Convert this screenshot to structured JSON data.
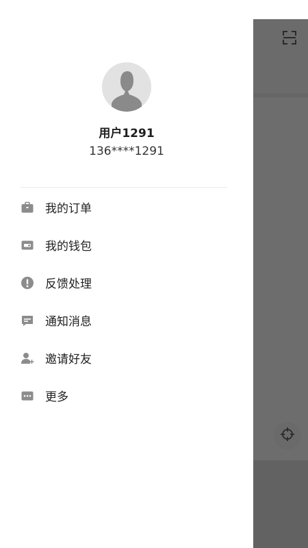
{
  "user": {
    "name": "用户1291",
    "phone": "136****1291",
    "avatar_icon": "avatar-placeholder-icon"
  },
  "menu": {
    "items": [
      {
        "label": "我的订单",
        "icon": "briefcase-icon"
      },
      {
        "label": "我的钱包",
        "icon": "wallet-icon"
      },
      {
        "label": "反馈处理",
        "icon": "exclamation-circle-icon"
      },
      {
        "label": "通知消息",
        "icon": "message-icon"
      },
      {
        "label": "邀请好友",
        "icon": "add-user-icon"
      },
      {
        "label": "更多",
        "icon": "more-icon"
      }
    ]
  },
  "underlay": {
    "top_action_icon": "scan-icon",
    "locate_icon": "crosshair-icon"
  },
  "colors": {
    "icon_gray": "#8c8c8c",
    "overlay_gray": "#6f6f6f"
  }
}
